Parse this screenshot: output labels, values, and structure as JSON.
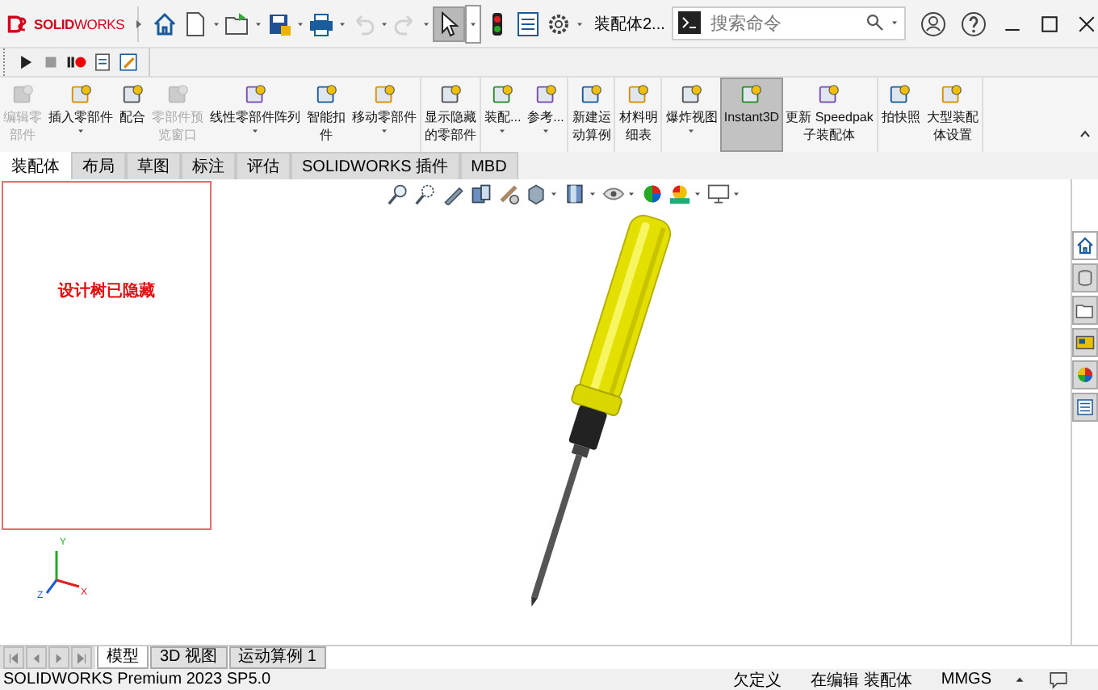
{
  "title_bar": {
    "logo": "**SOLID**WORKS",
    "document_title": "装配体2...",
    "search": {
      "placeholder": "搜索命令"
    },
    "tools": [
      {
        "kind": "home",
        "selected": false,
        "disabled": false
      },
      {
        "kind": "new",
        "selected": false,
        "disabled": false
      },
      {
        "kind": "open",
        "selected": false,
        "disabled": false
      },
      {
        "kind": "save",
        "selected": false,
        "disabled": false
      },
      {
        "kind": "print",
        "selected": false,
        "disabled": false
      },
      {
        "kind": "undo",
        "selected": false,
        "disabled": true
      },
      {
        "kind": "redo",
        "selected": false,
        "disabled": true
      },
      {
        "kind": "select",
        "selected": true,
        "disabled": false
      },
      {
        "kind": "light",
        "selected": false,
        "disabled": false
      },
      {
        "kind": "list",
        "selected": false,
        "disabled": false
      },
      {
        "kind": "gear",
        "selected": false,
        "disabled": false
      }
    ]
  },
  "macro_bar": [
    {
      "kind": "play"
    },
    {
      "kind": "stop"
    },
    {
      "kind": "record"
    },
    {
      "kind": "macro"
    },
    {
      "kind": "edit"
    }
  ],
  "command_manager": {
    "groups": [
      [
        {
          "lines": [
            "编辑零",
            "部件"
          ],
          "disabled": true,
          "selected": false,
          "dropdown": false
        },
        {
          "lines": [
            "插入零部件"
          ],
          "disabled": false,
          "selected": false,
          "dropdown": true
        },
        {
          "lines": [
            "配合"
          ],
          "disabled": false,
          "selected": false,
          "dropdown": false
        },
        {
          "lines": [
            "零部件预",
            "览窗口"
          ],
          "disabled": true,
          "selected": false,
          "dropdown": false
        },
        {
          "lines": [
            "线性零部件阵列"
          ],
          "disabled": false,
          "selected": false,
          "dropdown": true
        },
        {
          "lines": [
            "智能扣",
            "件"
          ],
          "disabled": false,
          "selected": false,
          "dropdown": false
        },
        {
          "lines": [
            "移动零部件"
          ],
          "disabled": false,
          "selected": false,
          "dropdown": true
        }
      ],
      [
        {
          "lines": [
            "显示隐藏",
            "的零部件"
          ],
          "disabled": false,
          "selected": false,
          "dropdown": false
        }
      ],
      [
        {
          "lines": [
            "装配..."
          ],
          "disabled": false,
          "selected": false,
          "dropdown": true
        },
        {
          "lines": [
            "参考..."
          ],
          "disabled": false,
          "selected": false,
          "dropdown": true
        }
      ],
      [
        {
          "lines": [
            "新建运",
            "动算例"
          ],
          "disabled": false,
          "selected": false,
          "dropdown": false
        }
      ],
      [
        {
          "lines": [
            "材料明",
            "细表"
          ],
          "disabled": false,
          "selected": false,
          "dropdown": false
        }
      ],
      [
        {
          "lines": [
            "爆炸视图"
          ],
          "disabled": false,
          "selected": false,
          "dropdown": true
        },
        {
          "lines": [
            "Instant3D"
          ],
          "disabled": false,
          "selected": true,
          "dropdown": false
        },
        {
          "lines": [
            "更新 Speedpak",
            "子装配体"
          ],
          "disabled": false,
          "selected": false,
          "dropdown": false
        }
      ],
      [
        {
          "lines": [
            "拍快照"
          ],
          "disabled": false,
          "selected": false,
          "dropdown": false
        },
        {
          "lines": [
            "大型装配",
            "体设置"
          ],
          "disabled": false,
          "selected": false,
          "dropdown": false
        }
      ]
    ]
  },
  "tabs": [
    {
      "label": "装配体",
      "selected": true
    },
    {
      "label": "布局",
      "selected": false
    },
    {
      "label": "草图",
      "selected": false
    },
    {
      "label": "标注",
      "selected": false
    },
    {
      "label": "评估",
      "selected": false
    },
    {
      "label": "SOLIDWORKS 插件",
      "selected": false
    },
    {
      "label": "MBD",
      "selected": false
    }
  ],
  "design_tree": {
    "message": "设计树已隐藏"
  },
  "triad": {
    "y": "Y",
    "x": "X",
    "z": "Z"
  },
  "task_pane": [
    {
      "kind": "home",
      "selected": true
    },
    {
      "kind": "parts",
      "selected": false
    },
    {
      "kind": "folder",
      "selected": false
    },
    {
      "kind": "palette",
      "selected": false
    },
    {
      "kind": "appearance",
      "selected": false
    },
    {
      "kind": "properties",
      "selected": false
    }
  ],
  "bottom_tabs": [
    {
      "label": "模型",
      "selected": true
    },
    {
      "label": "3D 视图",
      "selected": false
    },
    {
      "label": "运动算例 1",
      "selected": false
    }
  ],
  "status_bar": {
    "product": "SOLIDWORKS Premium 2023 SP5.0",
    "state": "欠定义",
    "mode": "在编辑 装配体",
    "units": "MMGS"
  }
}
